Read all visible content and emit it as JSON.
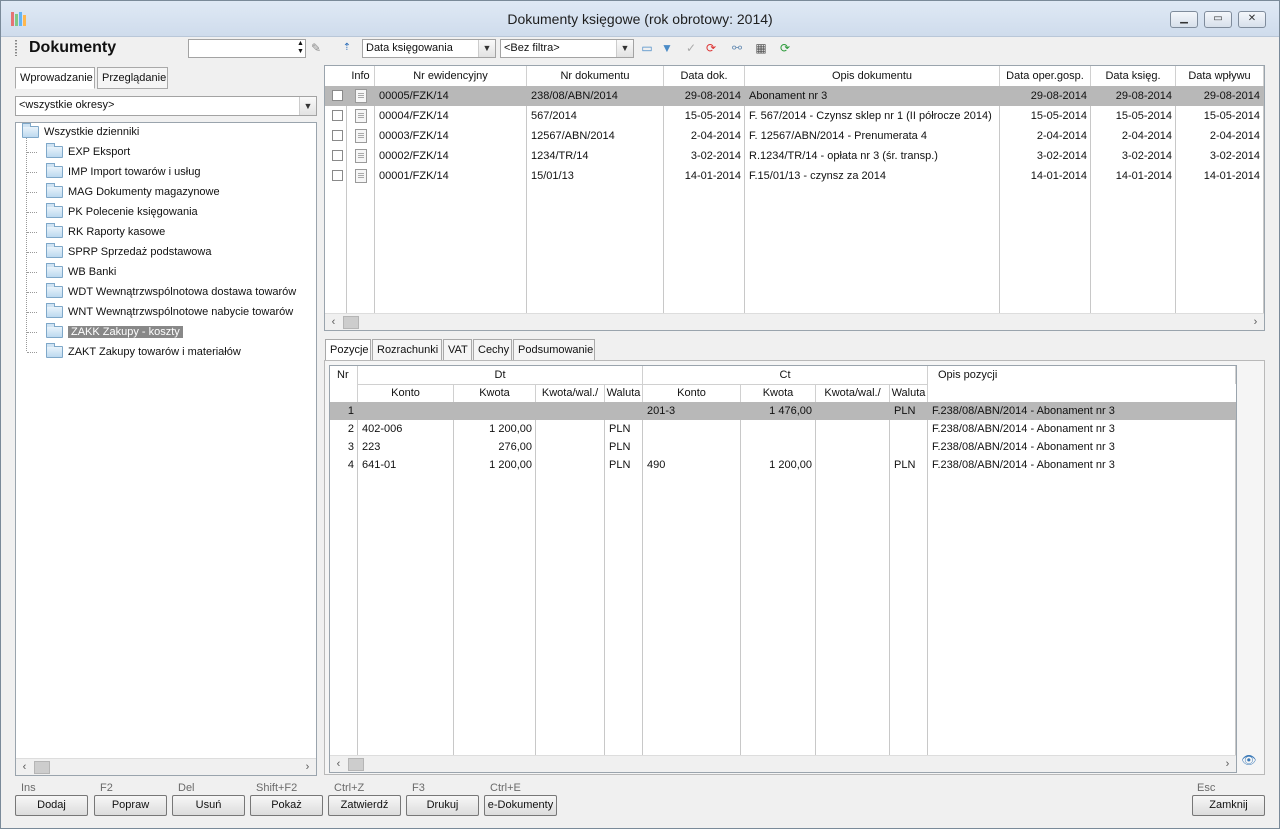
{
  "window": {
    "title": "Dokumenty księgowe (rok obrotowy: 2014)",
    "controls": [
      "minimize",
      "maximize",
      "close"
    ]
  },
  "toolbar": {
    "title": "Dokumenty",
    "search_value": "",
    "sort_field": "Data księgowania",
    "filter": "<Bez filtra>",
    "icons": [
      "pencil-icon",
      "sort-icon",
      "folder-icon",
      "funnel-icon",
      "check-icon",
      "refresh-red-icon",
      "link-icon",
      "table-icon",
      "refresh-green-icon"
    ]
  },
  "left_tabs": [
    {
      "label": "Wprowadzanie",
      "active": true
    },
    {
      "label": "Przeglądanie",
      "active": false
    }
  ],
  "period_select": "<wszystkie okresy>",
  "tree": {
    "root": "Wszystkie dzienniki",
    "items": [
      "EXP Eksport",
      "IMP Import towarów i usług",
      "MAG Dokumenty magazynowe",
      "PK Polecenie księgowania",
      "RK Raporty kasowe",
      "SPRP Sprzedaż podstawowa",
      "WB Banki",
      "WDT Wewnątrzwspólnotowa dostawa towarów",
      "WNT Wewnątrzwspólnotowe nabycie towarów",
      "ZAKK Zakupy - koszty",
      "ZAKT Zakupy towarów i materiałów"
    ],
    "selected_index": 9
  },
  "documents": {
    "headers": [
      "Info",
      "Nr ewidencyjny",
      "Nr dokumentu",
      "Data dok.",
      "Opis dokumentu",
      "Data oper.gosp.",
      "Data księg.",
      "Data wpływu"
    ],
    "rows": [
      [
        "00005/FZK/14",
        "238/08/ABN/2014",
        "29-08-2014",
        "Abonament nr 3",
        "29-08-2014",
        "29-08-2014",
        "29-08-2014"
      ],
      [
        "00004/FZK/14",
        "567/2014",
        "15-05-2014",
        "F. 567/2014 - Czynsz sklep nr 1 (II półrocze 2014)",
        "15-05-2014",
        "15-05-2014",
        "15-05-2014"
      ],
      [
        "00003/FZK/14",
        "12567/ABN/2014",
        "2-04-2014",
        "F. 12567/ABN/2014 - Prenumerata 4",
        "2-04-2014",
        "2-04-2014",
        "2-04-2014"
      ],
      [
        "00002/FZK/14",
        "1234/TR/14",
        "3-02-2014",
        "R.1234/TR/14 - opłata nr 3 (śr. transp.)",
        "3-02-2014",
        "3-02-2014",
        "3-02-2014"
      ],
      [
        "00001/FZK/14",
        "15/01/13",
        "14-01-2014",
        "F.15/01/13 - czynsz za 2014",
        "14-01-2014",
        "14-01-2014",
        "14-01-2014"
      ]
    ],
    "selected_index": 0
  },
  "detail_tabs": [
    {
      "label": "Pozycje",
      "active": true
    },
    {
      "label": "Rozrachunki",
      "active": false
    },
    {
      "label": "VAT",
      "active": false
    },
    {
      "label": "Cechy",
      "active": false
    },
    {
      "label": "Podsumowanie",
      "active": false
    }
  ],
  "positions": {
    "group_headers": {
      "nr": "Nr",
      "dt": "Dt",
      "ct": "Ct",
      "opis": "Opis pozycji"
    },
    "sub_headers": [
      "Konto",
      "Kwota",
      "Kwota/wal./",
      "Waluta",
      "Konto",
      "Kwota",
      "Kwota/wal./",
      "Waluta"
    ],
    "rows": [
      [
        "1",
        "",
        "",
        "",
        "",
        "201-3",
        "1 476,00",
        "",
        "PLN",
        "F.238/08/ABN/2014 - Abonament nr 3"
      ],
      [
        "2",
        "402-006",
        "1 200,00",
        "",
        "PLN",
        "",
        "",
        "",
        "",
        "F.238/08/ABN/2014 - Abonament nr 3"
      ],
      [
        "3",
        "223",
        "276,00",
        "",
        "PLN",
        "",
        "",
        "",
        "",
        "F.238/08/ABN/2014 - Abonament nr 3"
      ],
      [
        "4",
        "641-01",
        "1 200,00",
        "",
        "PLN",
        "490",
        "1 200,00",
        "",
        "PLN",
        "F.238/08/ABN/2014 - Abonament nr 3"
      ]
    ],
    "selected_index": 0
  },
  "buttons": [
    {
      "hotkey": "Ins",
      "label": "Dodaj"
    },
    {
      "hotkey": "F2",
      "label": "Popraw"
    },
    {
      "hotkey": "Del",
      "label": "Usuń"
    },
    {
      "hotkey": "Shift+F2",
      "label": "Pokaż"
    },
    {
      "hotkey": "Ctrl+Z",
      "label": "Zatwierdź"
    },
    {
      "hotkey": "F3",
      "label": "Drukuj"
    },
    {
      "hotkey": "Ctrl+E",
      "label": "e-Dokumenty"
    }
  ],
  "close_button": {
    "hotkey": "Esc",
    "label": "Zamknij"
  }
}
